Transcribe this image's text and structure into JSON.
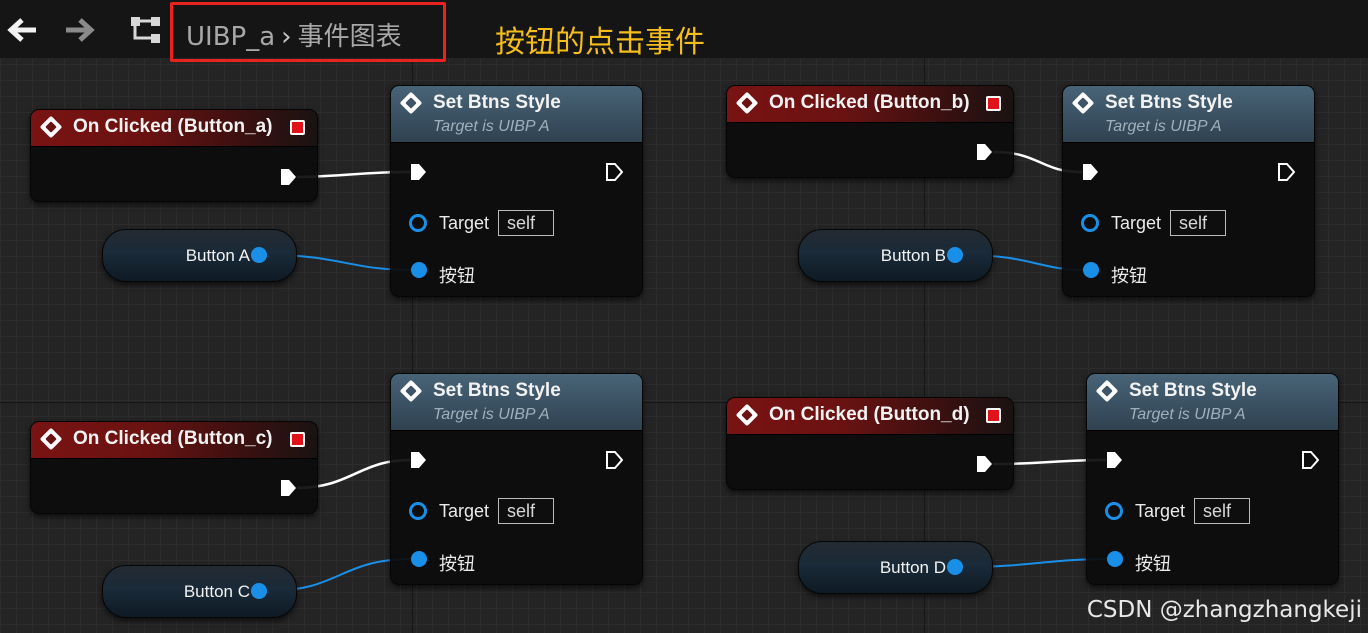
{
  "toolbar": {
    "breadcrumb_root": "UIBP_a",
    "breadcrumb_separator": "›",
    "breadcrumb_current": "事件图表"
  },
  "annotation": "按钮的点击事件",
  "events": [
    {
      "title": "On Clicked (Button_a)"
    },
    {
      "title": "On Clicked (Button_b)"
    },
    {
      "title": "On Clicked (Button_c)"
    },
    {
      "title": "On Clicked (Button_d)"
    }
  ],
  "functions": [
    {
      "title": "Set Btns Style",
      "subtitle": "Target is UIBP A",
      "target_label": "Target",
      "target_value": "self",
      "param_label": "按钮"
    },
    {
      "title": "Set Btns Style",
      "subtitle": "Target is UIBP A",
      "target_label": "Target",
      "target_value": "self",
      "param_label": "按钮"
    },
    {
      "title": "Set Btns Style",
      "subtitle": "Target is UIBP A",
      "target_label": "Target",
      "target_value": "self",
      "param_label": "按钮"
    },
    {
      "title": "Set Btns Style",
      "subtitle": "Target is UIBP A",
      "target_label": "Target",
      "target_value": "self",
      "param_label": "按钮"
    }
  ],
  "variables": [
    {
      "label": "Button A"
    },
    {
      "label": "Button B"
    },
    {
      "label": "Button C"
    },
    {
      "label": "Button D"
    }
  ],
  "watermark": "CSDN @zhangzhangkeji",
  "colors": {
    "exec_wire": "#ffffff",
    "object_wire": "#1a8fe8",
    "event_header": "#7a1313",
    "function_header": "#486477",
    "annotation": "#f4bd1c",
    "highlight_box": "#e8231f"
  }
}
